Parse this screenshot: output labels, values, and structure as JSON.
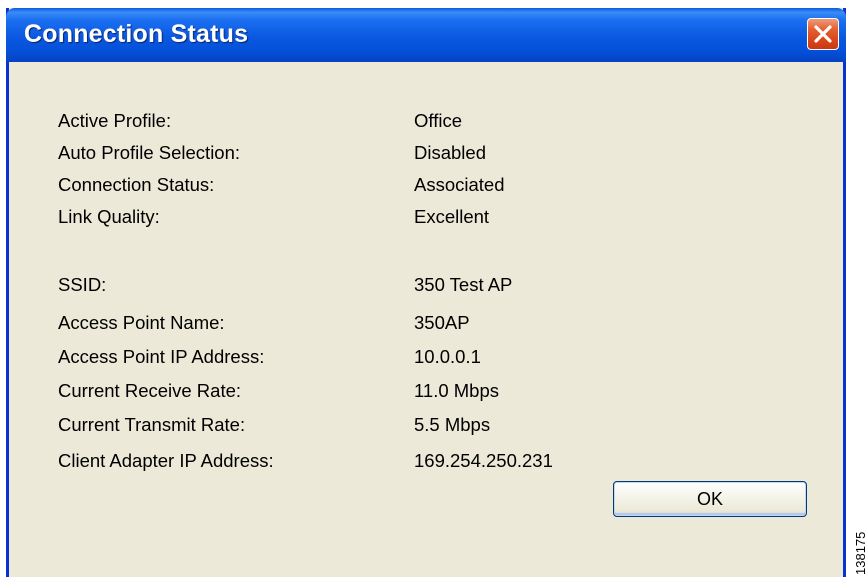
{
  "window": {
    "title": "Connection Status"
  },
  "status": {
    "group1": [
      {
        "label": "Active Profile:",
        "value": "Office"
      },
      {
        "label": "Auto Profile Selection:",
        "value": "Disabled"
      },
      {
        "label": "Connection Status:",
        "value": "Associated"
      },
      {
        "label": "Link Quality:",
        "value": "Excellent"
      }
    ],
    "group2": [
      {
        "label": "SSID:",
        "value": "350 Test AP"
      },
      {
        "label": "Access Point Name:",
        "value": "350AP"
      },
      {
        "label": "Access Point IP Address:",
        "value": "10.0.0.1"
      },
      {
        "label": "Current Receive Rate:",
        "value": "11.0 Mbps"
      },
      {
        "label": "Current Transmit Rate:",
        "value": "5.5 Mbps"
      },
      {
        "label": "Client Adapter IP Address:",
        "value": "169.254.250.231"
      }
    ]
  },
  "buttons": {
    "ok_label": "OK"
  },
  "icons": {
    "close": "close-icon"
  },
  "colors": {
    "titlebar": "#0a58e0",
    "window_body": "#ece9d8",
    "close_button": "#d9461b"
  },
  "figure_code": "138175"
}
